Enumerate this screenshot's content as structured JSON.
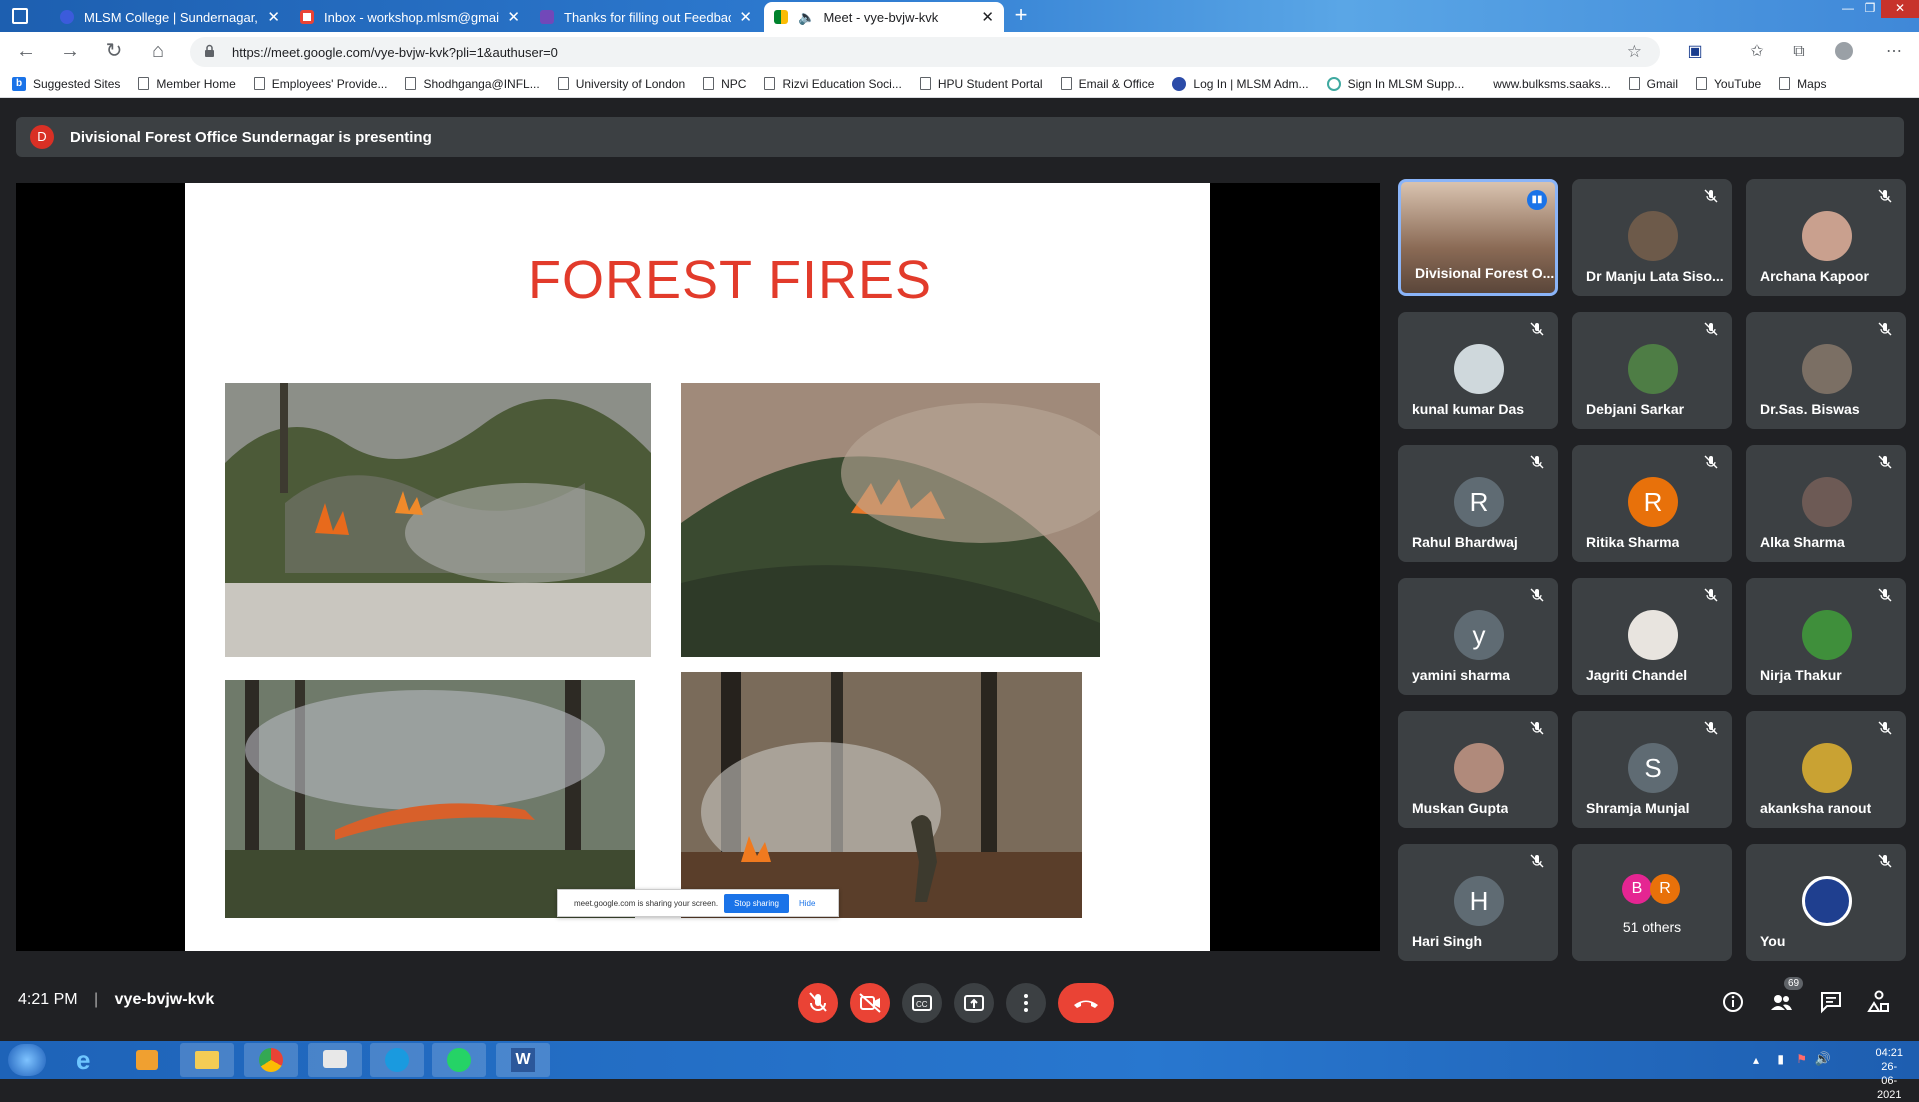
{
  "browser": {
    "tabs": [
      {
        "title": "MLSM College | Sundernagar, M",
        "active": false
      },
      {
        "title": "Inbox - workshop.mlsm@gmail.c",
        "active": false
      },
      {
        "title": "Thanks for filling out Feedback f",
        "active": false
      },
      {
        "title": "Meet - vye-bvjw-kvk",
        "active": true
      }
    ],
    "url": "https://meet.google.com/vye-bvjw-kvk?pli=1&authuser=0",
    "bookmarks": [
      "Suggested Sites",
      "Member Home",
      "Employees' Provide...",
      "Shodhganga@INFL...",
      "University of London",
      "NPC",
      "Rizvi Education Soci...",
      "HPU Student Portal",
      "Email & Office",
      "Log In | MLSM Adm...",
      "Sign In MLSM Supp...",
      "www.bulksms.saaks...",
      "Gmail",
      "YouTube",
      "Maps"
    ]
  },
  "meet": {
    "presenter_initial": "D",
    "presenting_banner": "Divisional Forest Office Sundernagar is presenting",
    "slide_title": "FOREST FIRES",
    "share_notice": {
      "text": "meet.google.com is sharing your screen.",
      "stop": "Stop sharing",
      "hide": "Hide"
    },
    "participants": [
      {
        "name": "Divisional Forest O...",
        "avatar": "video",
        "color": "#8a6a55"
      },
      {
        "name": "Dr Manju Lata Siso...",
        "avatar": "photo",
        "color": "#6d5a4a"
      },
      {
        "name": "Archana Kapoor",
        "avatar": "photo",
        "color": "#c9a08e"
      },
      {
        "name": "kunal kumar Das",
        "avatar": "photo",
        "color": "#cfd8dc"
      },
      {
        "name": "Debjani Sarkar",
        "avatar": "photo",
        "color": "#4e7d45"
      },
      {
        "name": "Dr.Sas. Biswas",
        "avatar": "photo",
        "color": "#7b6f64"
      },
      {
        "name": "Rahul Bhardwaj",
        "avatar": "R",
        "color": "#5f6b73"
      },
      {
        "name": "Ritika Sharma",
        "avatar": "R",
        "color": "#e8710a"
      },
      {
        "name": "Alka Sharma",
        "avatar": "photo",
        "color": "#6d5a55"
      },
      {
        "name": "yamini sharma",
        "avatar": "y",
        "color": "#5f6b73"
      },
      {
        "name": "Jagriti Chandel",
        "avatar": "photo",
        "color": "#e8e4df"
      },
      {
        "name": "Nirja Thakur",
        "avatar": "photo",
        "color": "#3f8f3b"
      },
      {
        "name": "Muskan Gupta",
        "avatar": "photo",
        "color": "#b08a7b"
      },
      {
        "name": "Shramja Munjal",
        "avatar": "S",
        "color": "#5f6b73"
      },
      {
        "name": "akanksha ranout",
        "avatar": "photo",
        "color": "#c9a233"
      },
      {
        "name": "Hari Singh",
        "avatar": "H",
        "color": "#5f6b73"
      },
      {
        "name": "51 others",
        "avatar": "group",
        "color": "#e52592",
        "group_initials": [
          "B",
          "R"
        ]
      },
      {
        "name": "You",
        "avatar": "emblem",
        "color": "#1f3f8f"
      }
    ],
    "time": "4:21 PM",
    "separator": "|",
    "meeting_code": "vye-bvjw-kvk",
    "people_count": "69",
    "colors": {
      "accent_red": "#ea4335",
      "tile_bg": "#3c4043",
      "bg": "#202124"
    }
  },
  "taskbar": {
    "time": "04:21",
    "date": "26-06-2021",
    "apps": [
      "start-orb",
      "internet-explorer",
      "media-player",
      "file-explorer",
      "chrome",
      "chat",
      "edge",
      "whatsapp",
      "word"
    ]
  }
}
